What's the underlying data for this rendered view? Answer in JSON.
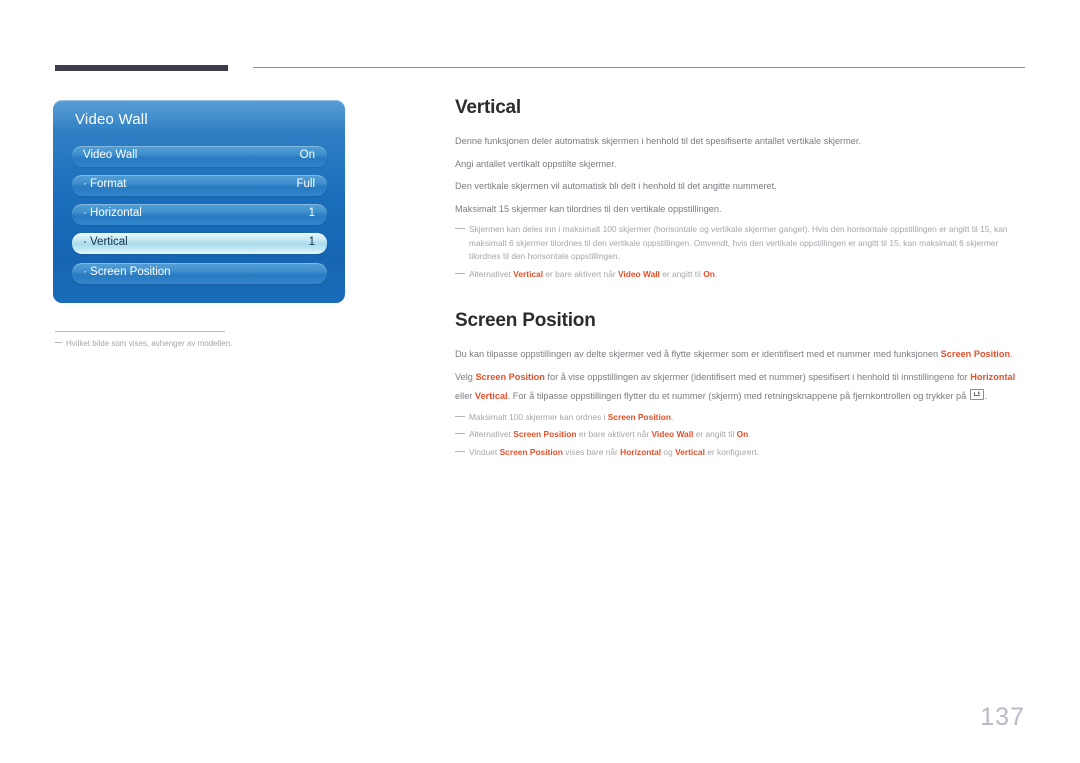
{
  "page": {
    "number": "137",
    "accent_color": "#e5502a",
    "header_bar_color": "#3f3b4a"
  },
  "osd": {
    "title": "Video Wall",
    "rows": [
      {
        "label": "Video Wall",
        "value": "On",
        "selected": false
      },
      {
        "label": "· Format",
        "value": "Full",
        "selected": false
      },
      {
        "label": "· Horizontal",
        "value": "1",
        "selected": false
      },
      {
        "label": "· Vertical",
        "value": "1",
        "selected": true
      },
      {
        "label": "· Screen Position",
        "value": "",
        "selected": false
      }
    ],
    "footnote": "Hvilket bilde som vises, avhenger av modellen."
  },
  "sections": {
    "vertical": {
      "title": "Vertical",
      "p1": "Denne funksjonen deler automatisk skjermen i henhold til det spesifiserte antallet vertikale skjermer.",
      "p2": "Angi antallet vertikalt oppstilte skjermer.",
      "p3": "Den vertikale skjermen vil automatisk bli delt i henhold til det angitte nummeret.",
      "p4": "Maksimalt 15 skjermer kan tilordnes til den vertikale oppstillingen.",
      "note1": "Skjermen kan deles inn i maksimalt 100 skjermer (horisontale og vertikale skjermer ganget). Hvis den horisontale oppstillingen er angitt til 15, kan maksimalt 6 skjermer tilordnes til den vertikale oppstillingen. Omvendt, hvis den vertikale oppstillingen er angitt til 15, kan maksimalt 6 skjermer tilordnes til den horisontale oppstillingen.",
      "note2_a": "Alternativet ",
      "note2_kw1": "Vertical",
      "note2_b": " er bare aktivert når ",
      "note2_kw2": "Video Wall",
      "note2_c": " er angitt til ",
      "note2_kw3": "On",
      "note2_d": "."
    },
    "screen_position": {
      "title": "Screen Position",
      "p1_a": "Du kan tilpasse oppstillingen av delte skjermer ved å flytte skjermer som er identifisert med et nummer med funksjonen ",
      "p1_kw": "Screen Position",
      "p1_b": ".",
      "p2_a": "Velg ",
      "p2_kw1": "Screen Position",
      "p2_b": " for å vise oppstillingen av skjermer (identifisert med et nummer) spesifisert i henhold til innstillingene for ",
      "p2_kw2": "Horizontal",
      "p2_c": " eller ",
      "p2_kw3": "Vertical",
      "p2_d": ". For å tilpasse oppstillingen flytter du et nummer (skjerm) med retningsknappene på fjernkontrollen og trykker på ",
      "p2_e": ".",
      "note1_a": "Maksimalt 100 skjermer kan ordnes i ",
      "note1_kw": "Screen Position",
      "note1_b": ".",
      "note2_a": "Alternativet ",
      "note2_kw1": "Screen Position",
      "note2_b": " er bare aktivert når ",
      "note2_kw2": "Video Wall",
      "note2_c": " er angitt til ",
      "note2_kw3": "On",
      "note2_d": ".",
      "note3_a": "Vinduet ",
      "note3_kw1": "Screen Position",
      "note3_b": " vises bare når ",
      "note3_kw2": "Horizontal",
      "note3_c": " og ",
      "note3_kw3": "Vertical",
      "note3_d": " er konfigurert."
    }
  }
}
